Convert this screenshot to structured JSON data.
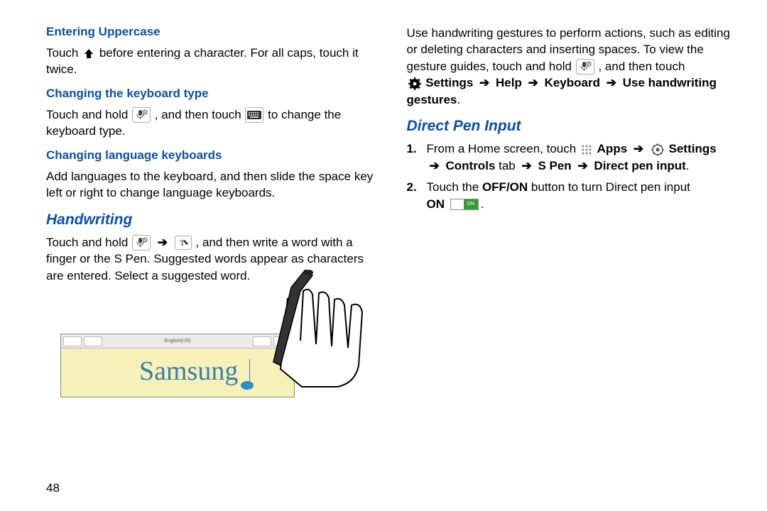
{
  "page_number": "48",
  "left": {
    "sec1_title": "Entering Uppercase",
    "sec1_pre": "Touch ",
    "sec1_post": " before entering a character. For all caps, touch it twice.",
    "sec2_title": "Changing the keyboard type",
    "sec2_pre": "Touch and hold ",
    "sec2_mid": " , and then touch ",
    "sec2_post": " to change the keyboard type.",
    "sec3_title": "Changing language keyboards",
    "sec3_body": "Add languages to the keyboard, and then slide the space key left or right to change language keyboards.",
    "sec4_title": "Handwriting",
    "sec4_pre": "Touch and hold ",
    "sec4_mid1": " ",
    "sec4_mid2": " , and then write a word with a finger or the S Pen. Suggested words appear as characters are entered. Select a suggested word.",
    "handwriting_sample": "Samsung",
    "handwriting_lang": "English(US)",
    "arrow": "➔"
  },
  "right": {
    "para1_pre": "Use handwriting gestures to perform actions, such as editing or deleting characters and inserting spaces. To view the gesture guides, touch and hold ",
    "para1_post": " , and then touch ",
    "gesture_path_1": "Settings",
    "gesture_path_2": "Help",
    "gesture_path_3": "Keyboard",
    "gesture_path_4": "Use handwriting gestures",
    "sec_title": "Direct Pen Input",
    "step1_pre": "From a Home screen, touch ",
    "step1_apps": "Apps",
    "step1_settings": "Settings",
    "step1_controls": "Controls",
    "step1_tab": " tab ",
    "step1_spen": "S Pen",
    "step1_dpi": "Direct pen input",
    "step2_pre": "Touch the ",
    "step2_offon": "OFF/ON",
    "step2_mid": " button to turn Direct pen input ",
    "step2_on": "ON",
    "toggle_label": "ON",
    "arrow": "➔"
  }
}
